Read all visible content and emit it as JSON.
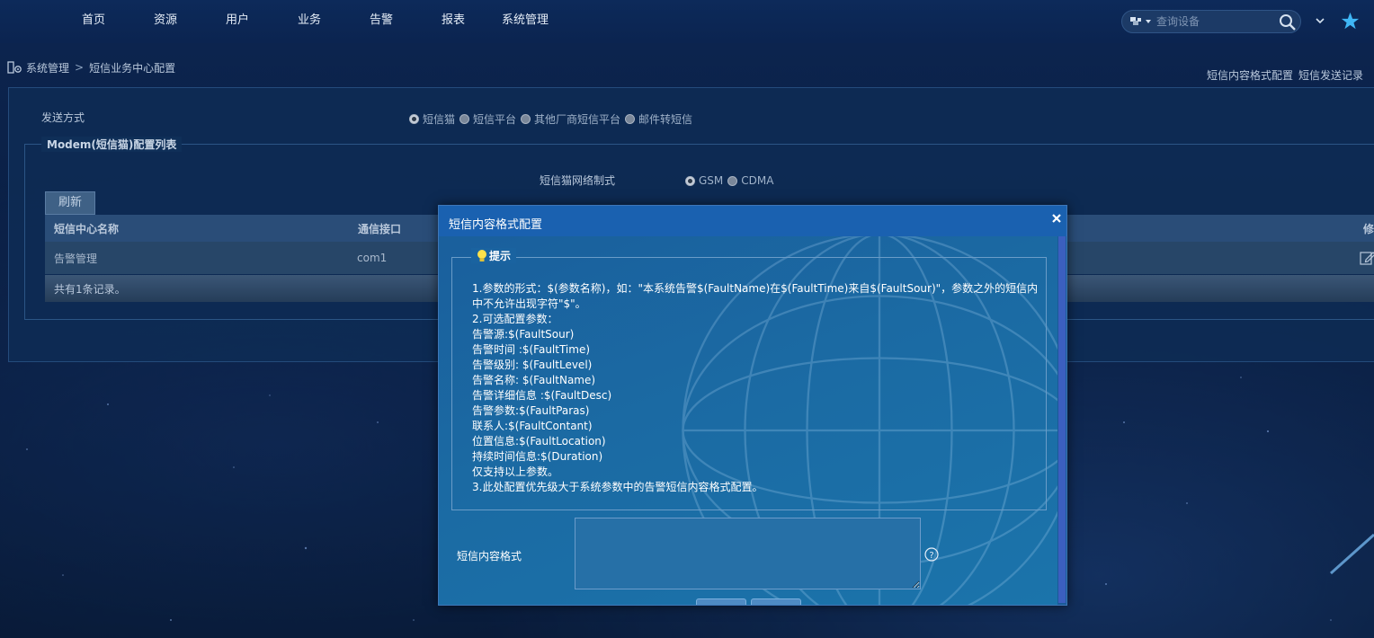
{
  "nav": {
    "items": [
      "首页",
      "资源",
      "用户",
      "业务",
      "告警",
      "报表",
      "系统管理"
    ]
  },
  "search": {
    "placeholder": "查询设备"
  },
  "colors": {
    "accent": "#3fb6f5",
    "header": "#1a61b0",
    "panel": "#0e2d56"
  },
  "icons": {
    "search_type": "device-type-icon",
    "search": "magnifier-icon",
    "expand": "chevron-down-icon",
    "favorite": "star-icon",
    "breadcrumb": "settings-icon",
    "edit": "edit-icon",
    "tip": "lightbulb-icon",
    "help": "question-icon",
    "close": "close-icon"
  },
  "breadcrumb": {
    "root": "系统管理",
    "sep": ">",
    "current": "短信业务中心配置"
  },
  "right_links": [
    "短信内容格式配置",
    "短信发送记录"
  ],
  "send_mode": {
    "label": "发送方式",
    "options": [
      "短信猫",
      "短信平台",
      "其他厂商短信平台",
      "邮件转短信"
    ],
    "selected": "短信猫"
  },
  "modem_section": {
    "legend": "Modem(短信猫)配置列表",
    "network_label": "短信猫网络制式",
    "network_options": [
      "GSM",
      "CDMA"
    ],
    "network_selected": "GSM",
    "refresh_label": "刷新",
    "columns": [
      "短信中心名称",
      "通信接口",
      "修"
    ],
    "rows": [
      {
        "name": "告警管理",
        "port": "com1"
      }
    ],
    "footer": "共有1条记录。"
  },
  "modal": {
    "title": "短信内容格式配置",
    "close": "×",
    "tip_title": "提示",
    "tip_lines": [
      "1.参数的形式：$(参数名称)，如：\"本系统告警$(FaultName)在$(FaultTime)来自$(FaultSour)\"，参数之外的短信内中不允许出现字符\"$\"。",
      "2.可选配置参数：",
      "告警源:$(FaultSour)",
      "告警时间 :$(FaultTime)",
      "告警级别: $(FaultLevel)",
      "告警名称: $(FaultName)",
      "告警详细信息 :$(FaultDesc)",
      "告警参数:$(FaultParas)",
      "联系人:$(FaultContant)",
      "位置信息:$(FaultLocation)",
      "持续时间信息:$(Duration)",
      "仅支持以上参数。",
      "3.此处配置优先级大于系统参数中的告警短信内容格式配置。"
    ],
    "field_label": "短信内容格式",
    "field_value": ""
  }
}
